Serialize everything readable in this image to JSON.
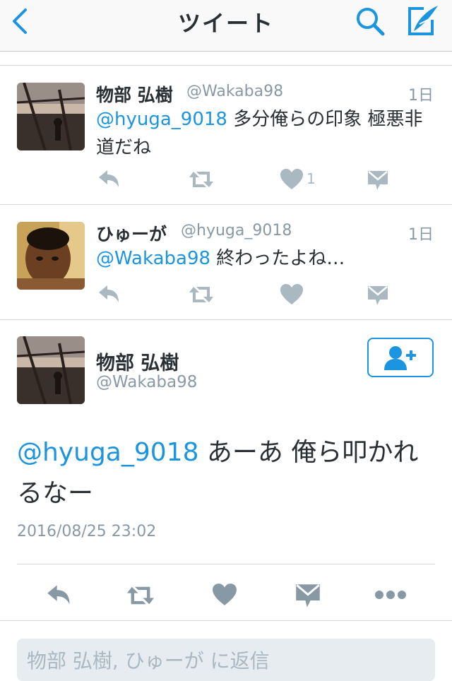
{
  "nav": {
    "title": "ツイート"
  },
  "tweets": [
    {
      "name": "物部 弘樹",
      "handle": "@Wakaba98",
      "time": "1日",
      "mention": "@hyuga_9018",
      "text_rest_line1": " 多分俺らの印象 極悪非",
      "text_line2": "道だね",
      "like_count": "1"
    },
    {
      "name": "ひゅーが",
      "handle": "@hyuga_9018",
      "time": "1日",
      "mention": "@Wakaba98",
      "text_rest_line1": " 終わったよね…",
      "like_count": ""
    }
  ],
  "focused": {
    "name": "物部 弘樹",
    "handle": "@Wakaba98",
    "mention": "@hyuga_9018",
    "text_rest_line1": " あーあ 俺ら叩かれ",
    "text_line2": "るなー",
    "timestamp": "2016/08/25 23:02"
  },
  "reply": {
    "placeholder": "物部 弘樹, ひゅーが に返信"
  },
  "colors": {
    "accent": "#1b95e0",
    "icon_gray": "#aab8c2",
    "text": "#292f33",
    "secondary": "#8899a6"
  },
  "icons": [
    "back-chevron-icon",
    "search-icon",
    "compose-icon",
    "reply-icon",
    "retweet-icon",
    "like-icon",
    "dm-icon",
    "follow-icon",
    "more-icon"
  ]
}
